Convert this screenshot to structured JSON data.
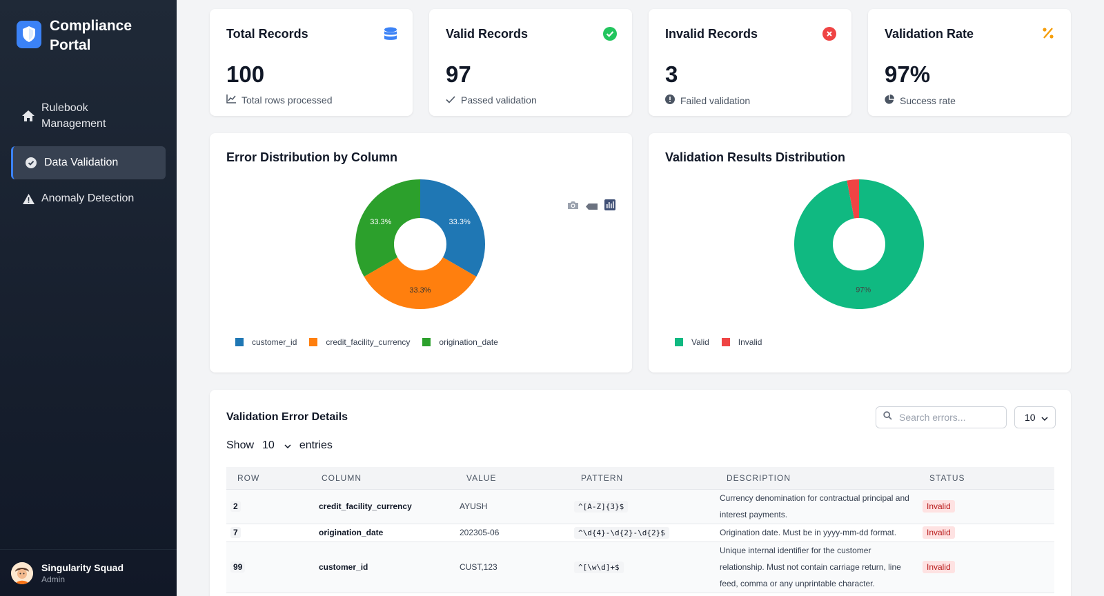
{
  "app": {
    "title": "Compliance Portal"
  },
  "sidebar": {
    "items": [
      {
        "label": "Rulebook Management",
        "icon": "home-icon"
      },
      {
        "label": "Data Validation",
        "icon": "check-circle-icon",
        "active": true
      },
      {
        "label": "Anomaly Detection",
        "icon": "warning-icon"
      }
    ]
  },
  "user": {
    "name": "Singularity Squad",
    "role": "Admin"
  },
  "stats": [
    {
      "title": "Total Records",
      "value": "100",
      "sub": "Total rows processed",
      "icon": "database-icon",
      "color": "#3b82f6"
    },
    {
      "title": "Valid Records",
      "value": "97",
      "sub": "Passed validation",
      "icon": "check-circle-icon",
      "color": "#22c55e"
    },
    {
      "title": "Invalid Records",
      "value": "3",
      "sub": "Failed validation",
      "icon": "x-circle-icon",
      "color": "#ef4444"
    },
    {
      "title": "Validation Rate",
      "value": "97%",
      "sub": "Success rate",
      "icon": "percent-icon",
      "color": "#f59e0b"
    }
  ],
  "chart_data": [
    {
      "type": "pie",
      "title": "Error Distribution by Column",
      "categories": [
        "customer_id",
        "credit_facility_currency",
        "origination_date"
      ],
      "values": [
        33.3,
        33.3,
        33.3
      ],
      "labels": [
        "33.3%",
        "33.3%",
        "33.3%"
      ],
      "colors": [
        "#1f77b4",
        "#ff7f0e",
        "#2ca02c"
      ],
      "donut": true,
      "legend": "bottom"
    },
    {
      "type": "pie",
      "title": "Validation Results Distribution",
      "categories": [
        "Valid",
        "Invalid"
      ],
      "values": [
        97,
        3
      ],
      "labels": [
        "97%",
        ""
      ],
      "colors": [
        "#10b981",
        "#ef4444"
      ],
      "donut": true,
      "legend": "bottom"
    }
  ],
  "table": {
    "title": "Validation Error Details",
    "search_placeholder": "Search errors...",
    "page_size": "10",
    "show_label": "Show",
    "show_value": "10",
    "entries_label": "entries",
    "columns": [
      "ROW",
      "COLUMN",
      "VALUE",
      "PATTERN",
      "DESCRIPTION",
      "STATUS"
    ],
    "rows": [
      {
        "row": "2",
        "column": "credit_facility_currency",
        "value": "AYUSH",
        "pattern": "^[A-Z]{3}$",
        "description": "Currency denomination for contractual principal and interest payments.",
        "status": "Invalid"
      },
      {
        "row": "7",
        "column": "origination_date",
        "value": "202305-06",
        "pattern": "^\\d{4}-\\d{2}-\\d{2}$",
        "description": "Origination date. Must be in yyyy-mm-dd format.",
        "status": "Invalid"
      },
      {
        "row": "99",
        "column": "customer_id",
        "value": "CUST,123",
        "pattern": "^[\\w\\d]+$",
        "description": "Unique internal identifier for the customer relationship. Must not contain carriage return, line feed, comma or any unprintable character.",
        "status": "Invalid"
      }
    ]
  }
}
